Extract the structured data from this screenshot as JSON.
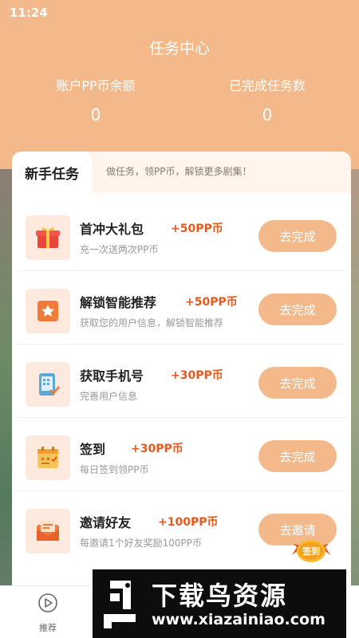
{
  "status_bar": {
    "time": "11:24"
  },
  "header": {
    "title": "任务中心",
    "balance_label": "账户PP币余额",
    "balance_value": "0",
    "completed_label": "已完成任务数",
    "completed_value": "0"
  },
  "tabs": {
    "active_label": "新手任务",
    "description": "做任务，领PP币，解锁更多剧集！"
  },
  "tasks": [
    {
      "name": "首冲大礼包",
      "reward": "+50PP币",
      "desc": "充一次送两次PP币",
      "button": "去完成",
      "icon": "gift-icon"
    },
    {
      "name": "解锁智能推荐",
      "reward": "+50PP币",
      "desc": "获取您的用户信息，解锁智能推荐",
      "button": "去完成",
      "icon": "star-icon"
    },
    {
      "name": "获取手机号",
      "reward": "+30PP币",
      "desc": "完善用户信息",
      "button": "去完成",
      "icon": "phone-icon"
    },
    {
      "name": "签到",
      "reward": "+30PP币",
      "desc": "每日签到领PP币",
      "button": "去完成",
      "icon": "calendar-icon"
    },
    {
      "name": "邀请好友",
      "reward": "+100PP币",
      "desc": "每邀请1个好友奖励100PP币",
      "button": "去邀请",
      "icon": "mail-icon"
    }
  ],
  "sign_badge": "签到",
  "bottom_nav": {
    "recommend_label": "推荐"
  },
  "watermark": {
    "title": "下载鸟资源",
    "url": "www.xiazainiao.com"
  },
  "colors": {
    "accent": "#f4b98a",
    "reward": "#e65a1e"
  }
}
